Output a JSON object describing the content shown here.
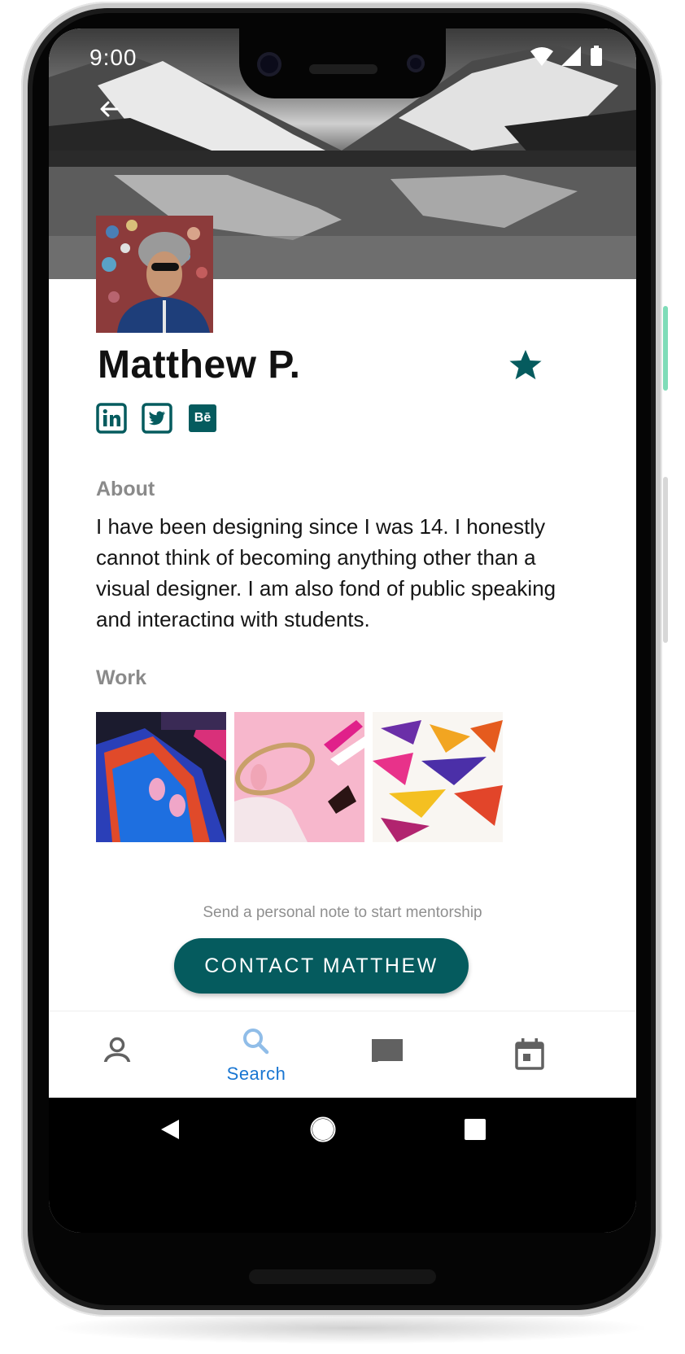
{
  "status_bar": {
    "time": "9:00"
  },
  "profile": {
    "name": "Matthew P.",
    "about_heading": "About",
    "about_text": "I have been designing since I was 14. I honestly cannot think of becoming anything other than a visual designer. I am also fond of public speaking and interacting with students.",
    "work_heading": "Work",
    "social_links": [
      "linkedin-icon",
      "twitter-icon",
      "behance-icon"
    ],
    "behance_glyph": "Bē"
  },
  "cta": {
    "note": "Send a personal note to start mentorship",
    "button_label": "CONTACT MATTHEW"
  },
  "bottom_nav": {
    "items": [
      {
        "icon": "person-icon",
        "label": ""
      },
      {
        "icon": "search-icon",
        "label": "Search",
        "active": true
      },
      {
        "icon": "chat-icon",
        "label": ""
      },
      {
        "icon": "calendar-icon",
        "label": ""
      }
    ]
  },
  "colors": {
    "accent": "#055b5e",
    "active_nav": "#1976d2",
    "muted_text": "#8a8a8a"
  }
}
